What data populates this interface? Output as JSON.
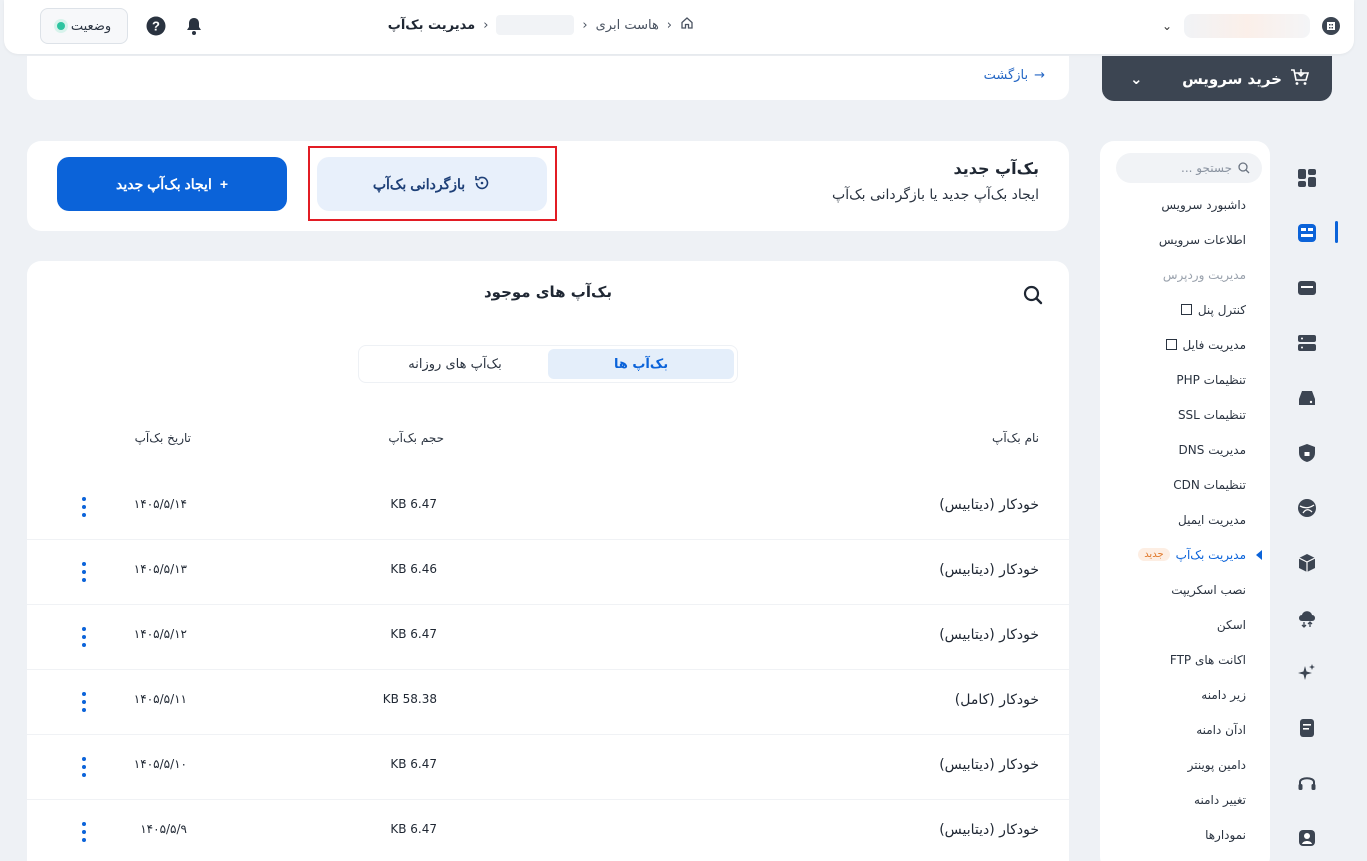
{
  "header": {
    "breadcrumb_home_icon": "home-icon",
    "breadcrumb": [
      "هاست ابری",
      "مدیریت بک‌آپ"
    ],
    "status_label": "وضعیت",
    "help_icon": "help-icon",
    "bell_icon": "bell-icon"
  },
  "backbar": {
    "back_label": "بازگشت"
  },
  "buy_service": {
    "label": "خرید سرویس"
  },
  "sidebar": {
    "search_placeholder": "جستجو ...",
    "items": [
      {
        "label": "داشبورد سرویس"
      },
      {
        "label": "اطلاعات سرویس"
      },
      {
        "label": "مدیریت وردپرس",
        "muted": true
      },
      {
        "label": "کنترل پنل",
        "external": true
      },
      {
        "label": "مدیریت فایل",
        "external": true
      },
      {
        "label": "تنظیمات PHP"
      },
      {
        "label": "تنظیمات SSL"
      },
      {
        "label": "مدیریت DNS"
      },
      {
        "label": "تنظیمات CDN"
      },
      {
        "label": "مدیریت ایمیل"
      },
      {
        "label": "مدیریت بک‌آپ",
        "active": true,
        "badge": "جدید"
      },
      {
        "label": "نصب اسکریپت"
      },
      {
        "label": "اسکن"
      },
      {
        "label": "اکانت های FTP"
      },
      {
        "label": "زیر دامنه"
      },
      {
        "label": "ادآن دامنه"
      },
      {
        "label": "دامین پوینتر"
      },
      {
        "label": "تغییر دامنه"
      },
      {
        "label": "نمودارها"
      }
    ]
  },
  "new_backup": {
    "title": "بک‌آپ جدید",
    "subtitle": "ایجاد بک‌آپ جدید یا بازگردانی بک‌آپ",
    "restore_label": "بازگردانی بک‌آپ",
    "create_label": "ایجاد بک‌آپ جدید"
  },
  "backup_list": {
    "title": "بک‌آپ های موجود",
    "tabs": [
      {
        "label": "بک‌آپ ها",
        "active": true
      },
      {
        "label": "بک‌آپ های روزانه",
        "active": false
      }
    ],
    "columns": {
      "name": "نام بک‌آپ",
      "size": "حجم بک‌آپ",
      "date": "تاریخ بک‌آپ"
    },
    "rows": [
      {
        "name": "خودکار (دیتابیس)",
        "size": "6.47 KB",
        "date": "۱۴۰۵/۵/۱۴"
      },
      {
        "name": "خودکار (دیتابیس)",
        "size": "6.46 KB",
        "date": "۱۴۰۵/۵/۱۳"
      },
      {
        "name": "خودکار (دیتابیس)",
        "size": "6.47 KB",
        "date": "۱۴۰۵/۵/۱۲"
      },
      {
        "name": "خودکار (کامل)",
        "size": "58.38 KB",
        "date": "۱۴۰۵/۵/۱۱"
      },
      {
        "name": "خودکار (دیتابیس)",
        "size": "6.47 KB",
        "date": "۱۴۰۵/۵/۱۰"
      },
      {
        "name": "خودکار (دیتابیس)",
        "size": "6.47 KB",
        "date": "۱۴۰۵/۵/۹"
      }
    ]
  },
  "colors": {
    "primary": "#0b63d9",
    "dark": "#3c4552",
    "highlight": "#e21c24"
  }
}
